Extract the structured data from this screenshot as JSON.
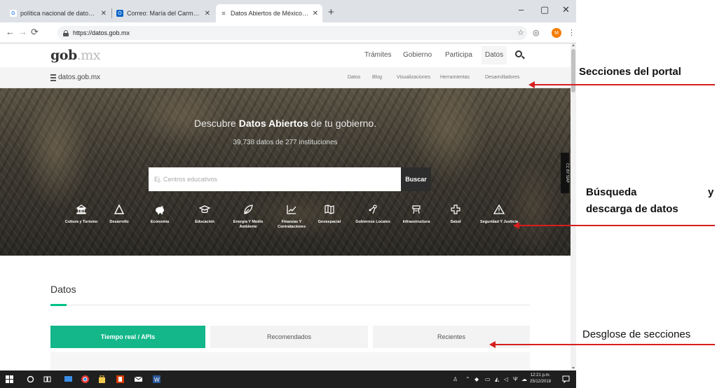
{
  "browser": {
    "tabs": [
      {
        "label": "política nacional de datos abiert",
        "favicon": "G",
        "favicon_color": "#4285f4",
        "active": false
      },
      {
        "label": "Correo: María del Carmen Santo",
        "favicon": "O",
        "favicon_color": "#0a64c9",
        "active": false
      },
      {
        "label": "Datos Abiertos de México - dato",
        "favicon": "≡",
        "favicon_color": "#555555",
        "active": true
      }
    ],
    "new_tab": "+",
    "window_controls": {
      "minimize": "–",
      "maximize": "▢",
      "close": "✕"
    },
    "nav": {
      "back": "←",
      "forward": "→",
      "reload": "⟳"
    },
    "url": "https://datos.gob.mx",
    "profile_initial": "M"
  },
  "site": {
    "logo_bold": "gob",
    "logo_suffix": ".mx",
    "nav_links": [
      "Trámites",
      "Gobierno",
      "Participa",
      "Datos"
    ],
    "active_nav": "Datos",
    "sub_logo": "datos.gob.mx",
    "sub_links": [
      "Datos",
      "Blog",
      "Visualizaciones",
      "Herramientas",
      "Desarrolladores"
    ]
  },
  "hero": {
    "title_prefix": "Descubre ",
    "title_bold": "Datos Abiertos",
    "title_suffix": " de tu gobierno.",
    "subtitle": "39,738 datos de 277 instituciones",
    "search_placeholder": "Ej. Centros educativos",
    "search_button": "Buscar",
    "badge": "CC BY SIAP",
    "categories": [
      {
        "label": "Cultura y Turismo",
        "icon": "museum-icon"
      },
      {
        "label": "Desarrollo",
        "icon": "triangle-icon"
      },
      {
        "label": "Economía",
        "icon": "piggy-bank-icon"
      },
      {
        "label": "Educación",
        "icon": "graduation-cap-icon"
      },
      {
        "label": "Energía Y Medio Ambiente",
        "icon": "leaf-icon"
      },
      {
        "label": "Finanzas Y Contrataciones",
        "icon": "trend-chart-icon"
      },
      {
        "label": "Geoespacial",
        "icon": "map-icon"
      },
      {
        "label": "Gobiernos Locales",
        "icon": "pin-network-icon"
      },
      {
        "label": "Infraestructura",
        "icon": "tower-icon"
      },
      {
        "label": "Salud",
        "icon": "medical-cross-icon"
      },
      {
        "label": "Seguridad Y Justicia",
        "icon": "warning-icon"
      }
    ]
  },
  "datos_section": {
    "heading": "Datos",
    "tabs": [
      "Tiempo real / APIs",
      "Recomendados",
      "Recientes"
    ],
    "active_tab": "Tiempo real / APIs"
  },
  "taskbar": {
    "time": "12:21 p.m.",
    "date": "25/12/2018"
  },
  "annotations": {
    "portal_sections": "Secciones del portal",
    "search_download_line1_left": "Búsqueda",
    "search_download_line1_right": "y",
    "search_download_line2": "descarga de datos",
    "sections_breakdown": "Desglose de secciones",
    "arrow_color": "#d81e1e"
  }
}
